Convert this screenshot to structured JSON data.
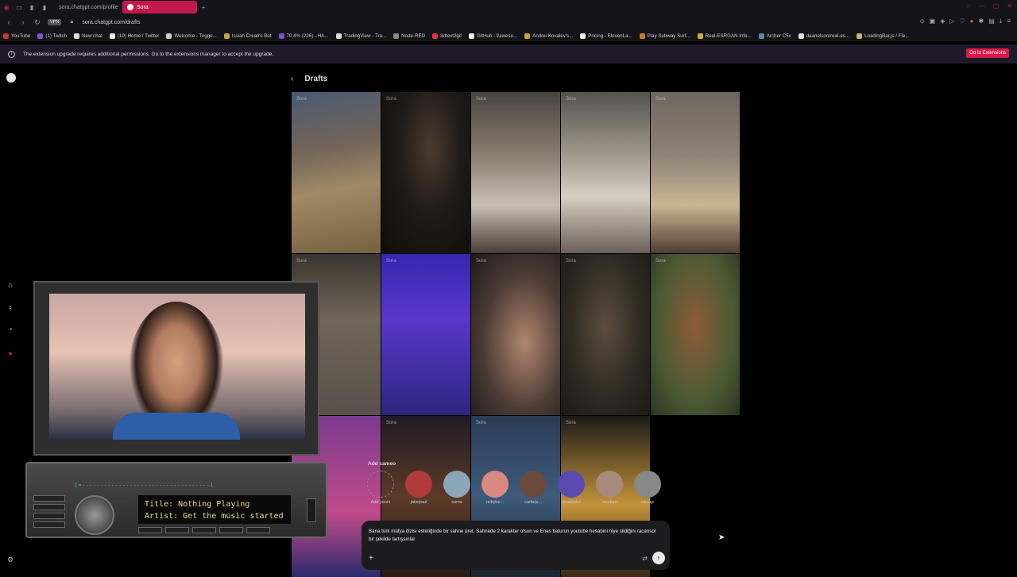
{
  "browser": {
    "tabs": [
      {
        "label": "sora.chatgpt.com/profile",
        "active": false
      },
      {
        "label": "Sora",
        "active": true
      }
    ],
    "new_tab_icon": "+",
    "url": "sora.chatgpt.com/drafts",
    "vpn_badge": "VPN",
    "bookmarks": [
      "YouTube",
      "(1) Twitch",
      "New chat",
      "(10) Home / Twitter",
      "Welcome - Trigge...",
      "Issiah Creati's Bot",
      "70.4% (226) - HA...",
      "TradingView - Tra...",
      "Node-RED",
      "3dtext2gif",
      "GitHub - f/aweso...",
      "Andrei Kovalev's...",
      "Pricing - ElevenLa...",
      "Play Subway Surf...",
      "Real-ESRGAN Infe...",
      "Archer C5v",
      "daanelson/real-es...",
      "LoadingBar.js / Fle..."
    ]
  },
  "notice": {
    "text": "The extension upgrade requires additional permissions. Go to the extensions manager to accept the upgrade.",
    "button": "Go to Extensions"
  },
  "page": {
    "title": "Drafts",
    "back_icon": "‹",
    "tile_watermark": "Sora"
  },
  "cameo": {
    "title": "Add cameo",
    "items": [
      "Add yours",
      "jakepaul",
      "sama",
      "rickybe...",
      "carterp...",
      "steakfake",
      "mcuban",
      "xqcxqc"
    ]
  },
  "prompt": {
    "text": "Bana türk mafya dizisi estetiğinde bir sahne üret. Sahnede 2 karakter olsun ve Enes baturun youtube hesabini niye sildiğini racansol bir şekilde tartışsınlar",
    "plus_icon": "+",
    "send_icon": "↑"
  },
  "overlay": {
    "radio_title": "Title: Nothing Playing",
    "radio_artist": "Artist: Get the music started",
    "eq_text": "[=-----------------------------------]"
  }
}
